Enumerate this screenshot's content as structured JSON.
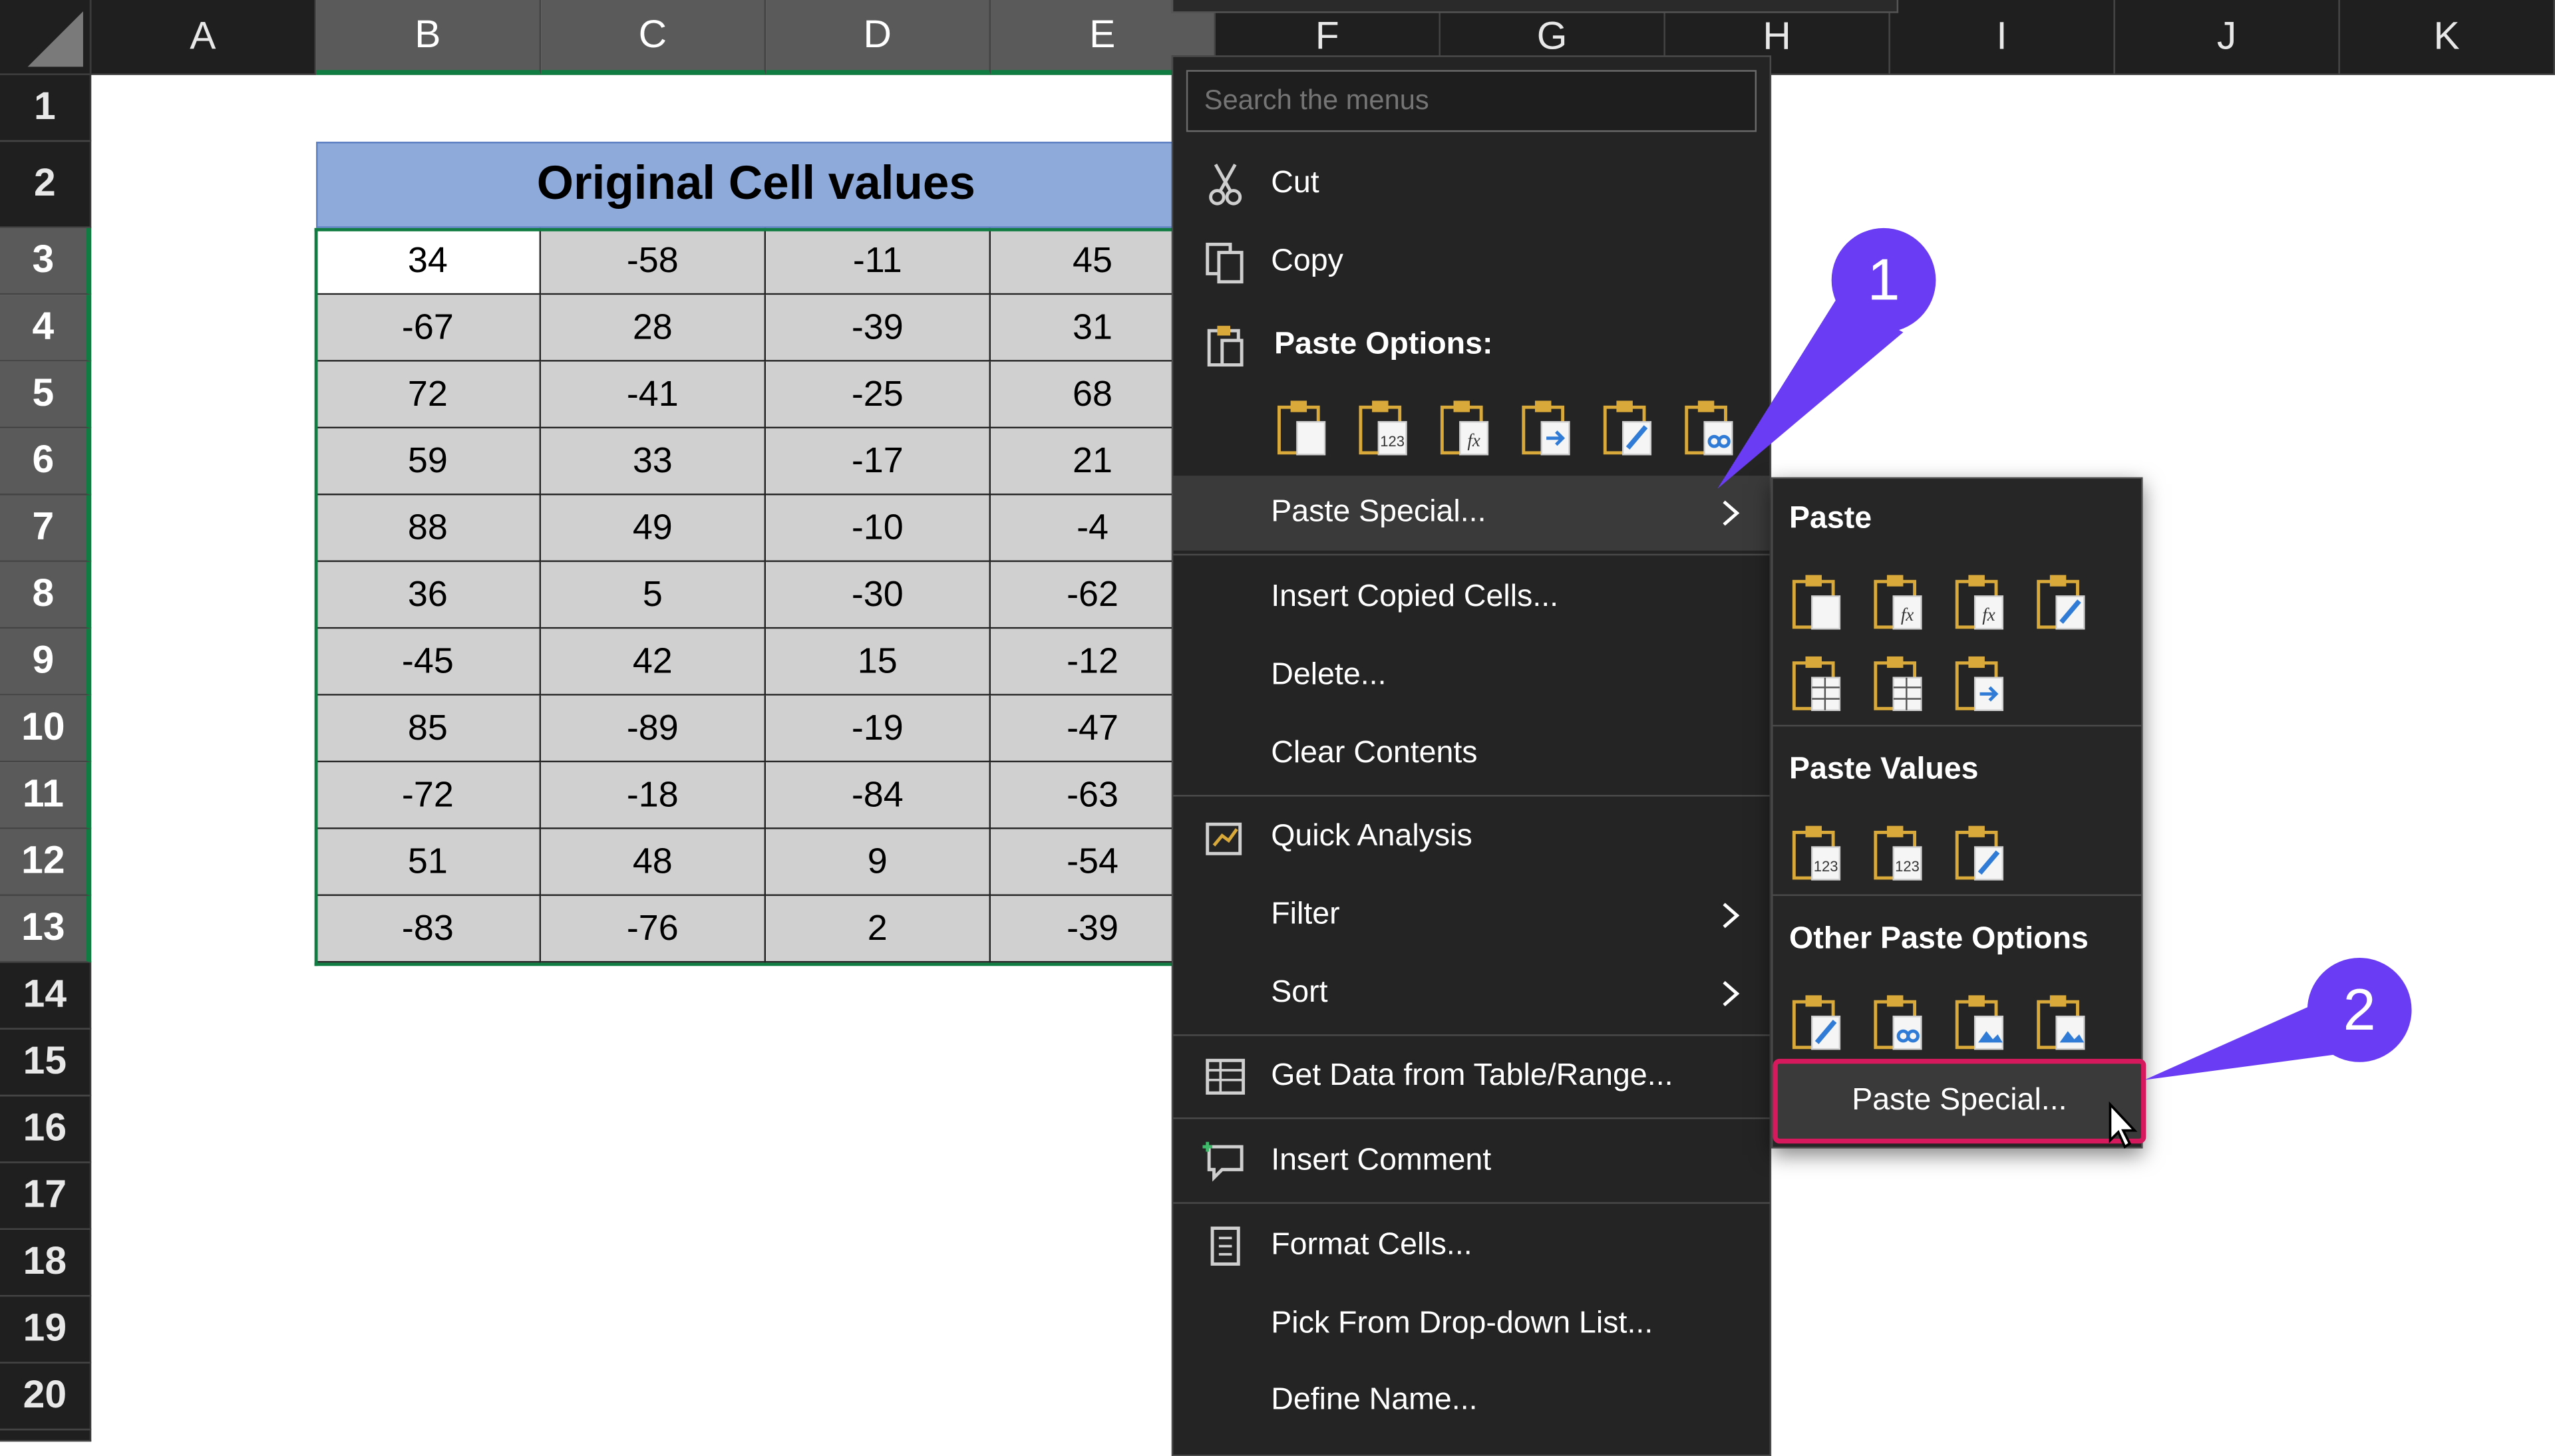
{
  "columns": [
    "A",
    "B",
    "C",
    "D",
    "E",
    "F",
    "G",
    "H",
    "I",
    "J",
    "K"
  ],
  "rows": [
    "1",
    "2",
    "3",
    "4",
    "5",
    "6",
    "7",
    "8",
    "9",
    "10",
    "11",
    "12",
    "13",
    "14",
    "15",
    "16",
    "17",
    "18",
    "19",
    "20"
  ],
  "table": {
    "title": "Original Cell values",
    "data": [
      [
        "34",
        "-58",
        "-11",
        "45"
      ],
      [
        "-67",
        "28",
        "-39",
        "31"
      ],
      [
        "72",
        "-41",
        "-25",
        "68"
      ],
      [
        "59",
        "33",
        "-17",
        "21"
      ],
      [
        "88",
        "49",
        "-10",
        "-4"
      ],
      [
        "36",
        "5",
        "-30",
        "-62"
      ],
      [
        "-45",
        "42",
        "15",
        "-12"
      ],
      [
        "85",
        "-89",
        "-19",
        "-47"
      ],
      [
        "-72",
        "-18",
        "-84",
        "-63"
      ],
      [
        "51",
        "48",
        "9",
        "-54"
      ],
      [
        "-83",
        "-76",
        "2",
        "-39"
      ]
    ]
  },
  "context_menu": {
    "search_placeholder": "Search the menus",
    "cut": "Cut",
    "copy": "Copy",
    "paste_options": "Paste Options:",
    "paste_special": "Paste Special...",
    "insert_copied_cells": "Insert Copied Cells...",
    "delete": "Delete...",
    "clear_contents": "Clear Contents",
    "quick_analysis": "Quick Analysis",
    "filter": "Filter",
    "sort": "Sort",
    "get_data": "Get Data from Table/Range...",
    "insert_comment": "Insert Comment",
    "format_cells": "Format Cells...",
    "pick_list": "Pick From Drop-down List...",
    "define_name": "Define Name..."
  },
  "submenu": {
    "paste": "Paste",
    "paste_values": "Paste Values",
    "other_paste_options": "Other Paste Options",
    "paste_special_button": "Paste Special..."
  },
  "callouts": [
    "1",
    "2"
  ],
  "colors": {
    "accent_green": "#107c41",
    "callout_purple": "#6a3df5",
    "highlight_pink": "#d6195c",
    "title_blue": "#8eaadb"
  }
}
